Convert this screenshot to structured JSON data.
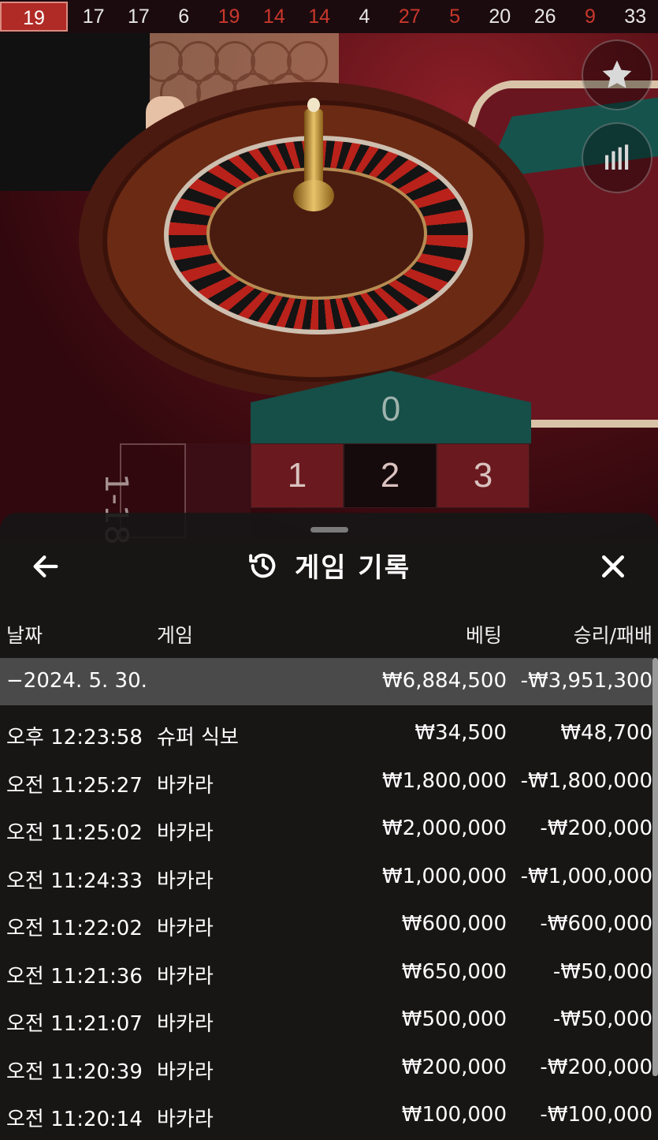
{
  "recent_numbers": [
    {
      "n": "19",
      "c": "red"
    },
    {
      "n": "17",
      "c": "black"
    },
    {
      "n": "17",
      "c": "black"
    },
    {
      "n": "6",
      "c": "black"
    },
    {
      "n": "19",
      "c": "red"
    },
    {
      "n": "14",
      "c": "red"
    },
    {
      "n": "14",
      "c": "red"
    },
    {
      "n": "4",
      "c": "black"
    },
    {
      "n": "27",
      "c": "red"
    },
    {
      "n": "5",
      "c": "red"
    },
    {
      "n": "20",
      "c": "black"
    },
    {
      "n": "26",
      "c": "black"
    },
    {
      "n": "9",
      "c": "red"
    },
    {
      "n": "33",
      "c": "black"
    }
  ],
  "side_buttons": {
    "favorite_icon": "star-icon",
    "stats_icon": "bar-chart-icon"
  },
  "board": {
    "zero": "0",
    "row1": [
      {
        "n": "1",
        "c": "red"
      },
      {
        "n": "2",
        "c": "black"
      },
      {
        "n": "3",
        "c": "red"
      }
    ],
    "side_label": "1-18"
  },
  "history": {
    "title": "게임 기록",
    "back_icon": "arrow-left-icon",
    "history_icon": "history-icon",
    "close_icon": "close-icon",
    "columns": {
      "date": "날짜",
      "game": "게임",
      "bet": "베팅",
      "win_loss": "승리/패배"
    },
    "day": {
      "date": "−2024. 5. 30.",
      "bet": "₩6,884,500",
      "win_loss": "-₩3,951,300"
    },
    "rows": [
      {
        "time": "오후 12:23:58",
        "game": "슈퍼 식보",
        "bet": "₩34,500",
        "win_loss": "₩48,700"
      },
      {
        "time": "오전 11:25:27",
        "game": "바카라",
        "bet": "₩1,800,000",
        "win_loss": "-₩1,800,000"
      },
      {
        "time": "오전 11:25:02",
        "game": "바카라",
        "bet": "₩2,000,000",
        "win_loss": "-₩200,000"
      },
      {
        "time": "오전 11:24:33",
        "game": "바카라",
        "bet": "₩1,000,000",
        "win_loss": "-₩1,000,000"
      },
      {
        "time": "오전 11:22:02",
        "game": "바카라",
        "bet": "₩600,000",
        "win_loss": "-₩600,000"
      },
      {
        "time": "오전 11:21:36",
        "game": "바카라",
        "bet": "₩650,000",
        "win_loss": "-₩50,000"
      },
      {
        "time": "오전 11:21:07",
        "game": "바카라",
        "bet": "₩500,000",
        "win_loss": "-₩50,000"
      },
      {
        "time": "오전 11:20:39",
        "game": "바카라",
        "bet": "₩200,000",
        "win_loss": "-₩200,000"
      },
      {
        "time": "오전 11:20:14",
        "game": "바카라",
        "bet": "₩100,000",
        "win_loss": "-₩100,000"
      }
    ]
  }
}
